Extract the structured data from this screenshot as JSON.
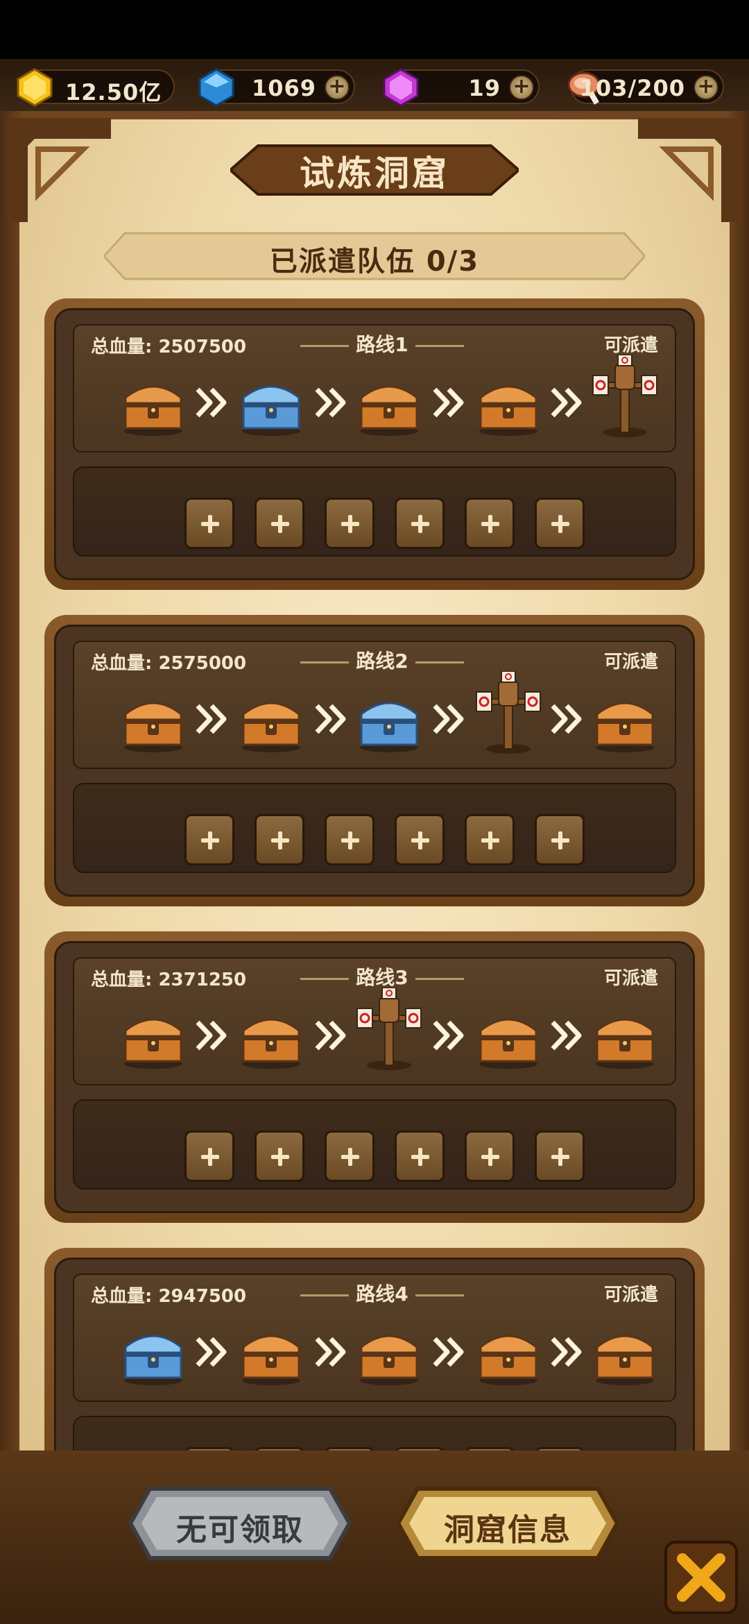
{
  "resources": {
    "gold": {
      "value": "12.50亿",
      "icon": "gold-gem-icon"
    },
    "diamond": {
      "value": "1069",
      "icon": "blue-diamond-icon"
    },
    "crystal": {
      "value": "19",
      "icon": "purple-crystal-icon"
    },
    "stamina": {
      "value": "103/200",
      "icon": "meat-icon"
    }
  },
  "title": "试炼洞窟",
  "team_status": "已派遣队伍   0/3",
  "routes": [
    {
      "hp": "总血量: 2507500",
      "name": "路线1",
      "status": "可派遣",
      "stages": [
        "orange-chest",
        "blue-chest",
        "orange-chest",
        "orange-chest",
        "target-dummy"
      ]
    },
    {
      "hp": "总血量: 2575000",
      "name": "路线2",
      "status": "可派遣",
      "stages": [
        "orange-chest",
        "orange-chest",
        "blue-chest",
        "target-dummy",
        "orange-chest"
      ]
    },
    {
      "hp": "总血量: 2371250",
      "name": "路线3",
      "status": "可派遣",
      "stages": [
        "orange-chest",
        "orange-chest",
        "target-dummy",
        "orange-chest",
        "orange-chest"
      ]
    },
    {
      "hp": "总血量: 2947500",
      "name": "路线4",
      "status": "可派遣",
      "stages": [
        "blue-chest",
        "orange-chest",
        "orange-chest",
        "orange-chest",
        "orange-chest"
      ]
    }
  ],
  "buttons": {
    "claim": "无可领取",
    "info": "洞窟信息"
  },
  "colors": {
    "parchment": "#eed8a8",
    "card": "#4b3522",
    "frame": "#6e4520",
    "text_light": "#f3e6cc",
    "text_dark": "#4a2a10"
  }
}
